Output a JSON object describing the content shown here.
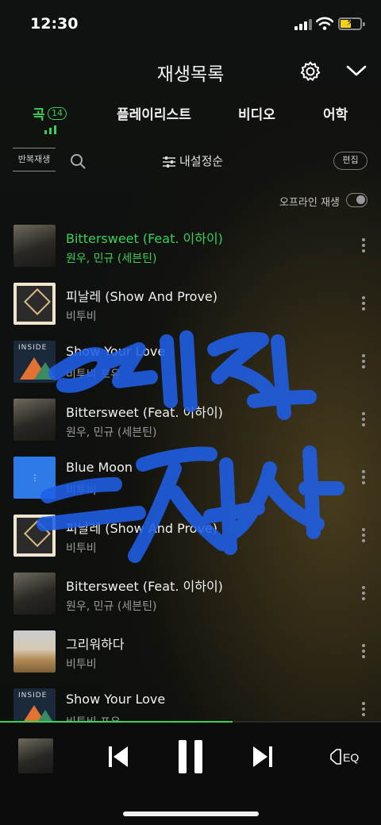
{
  "status_bar": {
    "time": "12:30"
  },
  "header": {
    "title": "재생목록"
  },
  "tabs": [
    {
      "label": "곡",
      "badge": "14",
      "active": true
    },
    {
      "label": "플레이리스트"
    },
    {
      "label": "비디오"
    },
    {
      "label": "어학"
    }
  ],
  "toolbar": {
    "repeat_label": "반복재생",
    "sort_label": "내설정순",
    "edit_label": "편집"
  },
  "offline": {
    "label": "오프라인 재생",
    "enabled": false
  },
  "songs": [
    {
      "title": "Bittersweet (Feat. 이하이)",
      "artist": "원우, 민규 (세븐틴)",
      "art": "bittersweet",
      "playing": true
    },
    {
      "title": "피날레 (Show And Prove)",
      "artist": "비투비",
      "art": "zib"
    },
    {
      "title": "Show Your Love",
      "artist": "비투비 포유",
      "art": "inside"
    },
    {
      "title": "Bittersweet (Feat. 이하이)",
      "artist": "원우, 민규 (세븐틴)",
      "art": "bittersweet"
    },
    {
      "title": "Blue Moon",
      "artist": "비투비",
      "art": "bluemoon"
    },
    {
      "title": "피날레 (Show And Prove)",
      "artist": "비투비",
      "art": "zib"
    },
    {
      "title": "Bittersweet (Feat. 이하이)",
      "artist": "원우, 민규 (세븐틴)",
      "art": "bittersweet"
    },
    {
      "title": "그리워하다",
      "artist": "비투비",
      "art": "grain"
    },
    {
      "title": "Show Your Love",
      "artist": "비투비 포유",
      "art": "inside"
    }
  ],
  "player": {
    "progress": 0.61,
    "eq_label": "EQ"
  },
  "colors": {
    "accent": "#3dd058",
    "scribble": "#1f5fe8"
  }
}
